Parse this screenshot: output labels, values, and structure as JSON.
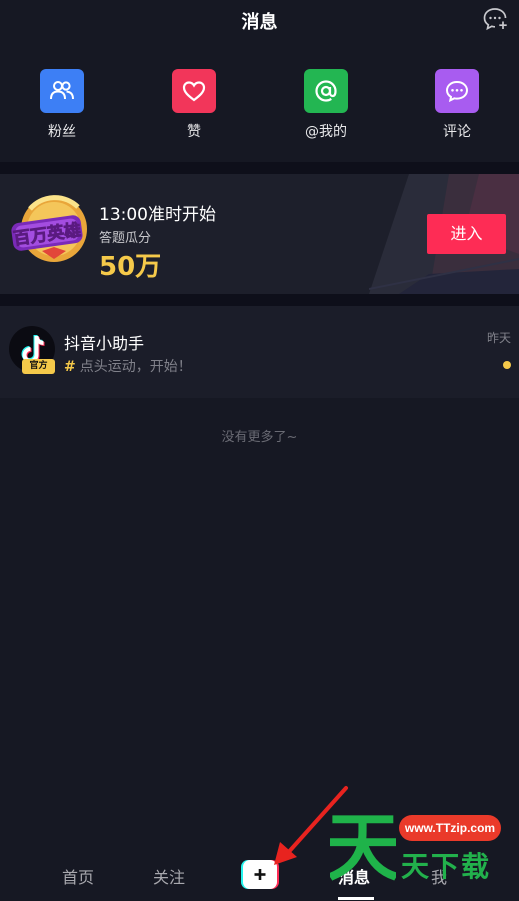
{
  "header": {
    "title": "消息"
  },
  "quick_actions": [
    {
      "label": "粉丝",
      "icon": "fans-icon",
      "color": "#3d7ff5"
    },
    {
      "label": "赞",
      "icon": "heart-icon",
      "color": "#f2365a"
    },
    {
      "label": "@我的",
      "icon": "at-icon",
      "color": "#23b652"
    },
    {
      "label": "评论",
      "icon": "comment-icon",
      "color": "#a85cf0"
    }
  ],
  "banner": {
    "logo_text": "百万英雄",
    "time_text": "13:00准时开始",
    "subtitle": "答题瓜分",
    "amount": "50万",
    "enter_label": "进入"
  },
  "messages": [
    {
      "name": "抖音小助手",
      "badge": "官方",
      "preview": "点头运动，开始！",
      "date": "昨天",
      "unread": true
    }
  ],
  "end_text": "没有更多了~",
  "tabbar": {
    "tabs": [
      {
        "label": "首页"
      },
      {
        "label": "关注"
      },
      {
        "label": "消息",
        "active": true
      },
      {
        "label": "我"
      }
    ],
    "plus_label": "+"
  },
  "watermark": {
    "url": "www.TTzip.com",
    "big_char": "天",
    "text": "天下载"
  },
  "colors": {
    "background": "#161823",
    "accent_red": "#fe2c55",
    "gold": "#f5c94a"
  }
}
